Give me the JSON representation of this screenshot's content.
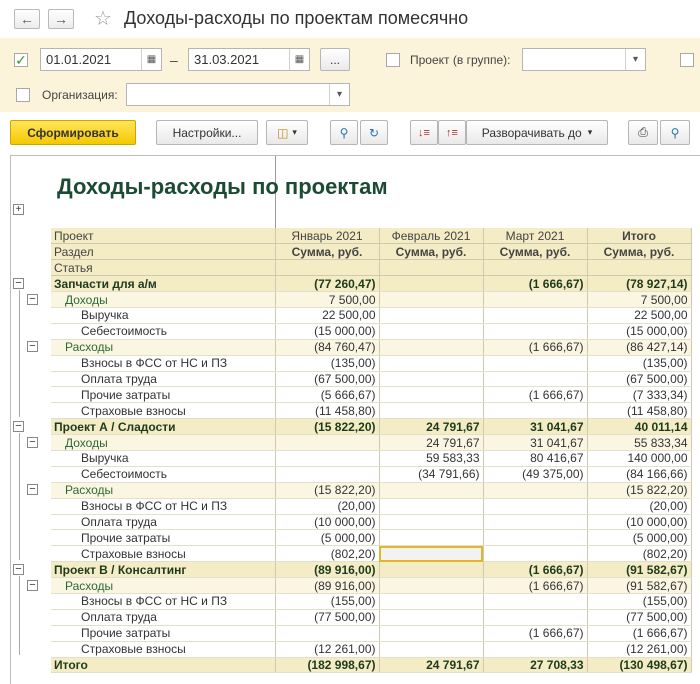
{
  "window": {
    "title": "Доходы-расходы по проектам помесячно"
  },
  "filters": {
    "period_checked": true,
    "date_from": "01.01.2021",
    "date_to": "31.03.2021",
    "dash": "–",
    "ellipsis": "...",
    "project_label": "Проект (в группе):",
    "project_value": "",
    "org_label": "Организация:",
    "org_value": ""
  },
  "toolbar": {
    "generate": "Сформировать",
    "settings": "Настройки...",
    "expand": "Разворачивать до"
  },
  "report": {
    "title": "Доходы-расходы по проектам",
    "header": {
      "row1": [
        "Проект",
        "Январь 2021",
        "Февраль 2021",
        "Март 2021",
        "Итого"
      ],
      "row2": [
        "Раздел",
        "Сумма, руб.",
        "Сумма, руб.",
        "Сумма, руб.",
        "Сумма, руб."
      ],
      "row3": [
        "Статья"
      ]
    },
    "rows": [
      {
        "level": 0,
        "name": "Запчасти для а/м",
        "jan": "(77 260,47)",
        "feb": "",
        "mar": "(1 666,67)",
        "total": "(78 927,14)"
      },
      {
        "level": 1,
        "name": "Доходы",
        "jan": "7 500,00",
        "feb": "",
        "mar": "",
        "total": "7 500,00"
      },
      {
        "level": 2,
        "name": "Выручка",
        "jan": "22 500,00",
        "feb": "",
        "mar": "",
        "total": "22 500,00"
      },
      {
        "level": 2,
        "name": "Себестоимость",
        "jan": "(15 000,00)",
        "feb": "",
        "mar": "",
        "total": "(15 000,00)"
      },
      {
        "level": 1,
        "name": "Расходы",
        "jan": "(84 760,47)",
        "feb": "",
        "mar": "(1 666,67)",
        "total": "(86 427,14)"
      },
      {
        "level": 2,
        "name": "Взносы в ФСС от НС и ПЗ",
        "jan": "(135,00)",
        "feb": "",
        "mar": "",
        "total": "(135,00)"
      },
      {
        "level": 2,
        "name": "Оплата труда",
        "jan": "(67 500,00)",
        "feb": "",
        "mar": "",
        "total": "(67 500,00)"
      },
      {
        "level": 2,
        "name": "Прочие затраты",
        "jan": "(5 666,67)",
        "feb": "",
        "mar": "(1 666,67)",
        "total": "(7 333,34)"
      },
      {
        "level": 2,
        "name": "Страховые взносы",
        "jan": "(11 458,80)",
        "feb": "",
        "mar": "",
        "total": "(11 458,80)"
      },
      {
        "level": 0,
        "name": "Проект А / Сладости",
        "jan": "(15 822,20)",
        "feb": "24 791,67",
        "mar": "31 041,67",
        "total": "40 011,14"
      },
      {
        "level": 1,
        "name": "Доходы",
        "jan": "",
        "feb": "24 791,67",
        "mar": "31 041,67",
        "total": "55 833,34"
      },
      {
        "level": 2,
        "name": "Выручка",
        "jan": "",
        "feb": "59 583,33",
        "mar": "80 416,67",
        "total": "140 000,00"
      },
      {
        "level": 2,
        "name": "Себестоимость",
        "jan": "",
        "feb": "(34 791,66)",
        "mar": "(49 375,00)",
        "total": "(84 166,66)"
      },
      {
        "level": 1,
        "name": "Расходы",
        "jan": "(15 822,20)",
        "feb": "",
        "mar": "",
        "total": "(15 822,20)"
      },
      {
        "level": 2,
        "name": "Взносы в ФСС от НС и ПЗ",
        "jan": "(20,00)",
        "feb": "",
        "mar": "",
        "total": "(20,00)"
      },
      {
        "level": 2,
        "name": "Оплата труда",
        "jan": "(10 000,00)",
        "feb": "",
        "mar": "",
        "total": "(10 000,00)"
      },
      {
        "level": 2,
        "name": "Прочие затраты",
        "jan": "(5 000,00)",
        "feb": "",
        "mar": "",
        "total": "(5 000,00)"
      },
      {
        "level": 2,
        "name": "Страховые взносы",
        "jan": "(802,20)",
        "feb": "",
        "mar": "",
        "total": "(802,20)",
        "selected_col": "feb"
      },
      {
        "level": 0,
        "name": "Проект В / Консалтинг",
        "jan": "(89 916,00)",
        "feb": "",
        "mar": "(1 666,67)",
        "total": "(91 582,67)"
      },
      {
        "level": 1,
        "name": "Расходы",
        "jan": "(89 916,00)",
        "feb": "",
        "mar": "(1 666,67)",
        "total": "(91 582,67)"
      },
      {
        "level": 2,
        "name": "Взносы в ФСС от НС и ПЗ",
        "jan": "(155,00)",
        "feb": "",
        "mar": "",
        "total": "(155,00)"
      },
      {
        "level": 2,
        "name": "Оплата труда",
        "jan": "(77 500,00)",
        "feb": "",
        "mar": "",
        "total": "(77 500,00)"
      },
      {
        "level": 2,
        "name": "Прочие затраты",
        "jan": "",
        "feb": "",
        "mar": "(1 666,67)",
        "total": "(1 666,67)"
      },
      {
        "level": 2,
        "name": "Страховые взносы",
        "jan": "(12 261,00)",
        "feb": "",
        "mar": "",
        "total": "(12 261,00)"
      }
    ],
    "total": {
      "name": "Итого",
      "jan": "(182 998,67)",
      "feb": "24 791,67",
      "mar": "27 708,33",
      "total": "(130 498,67)"
    }
  }
}
